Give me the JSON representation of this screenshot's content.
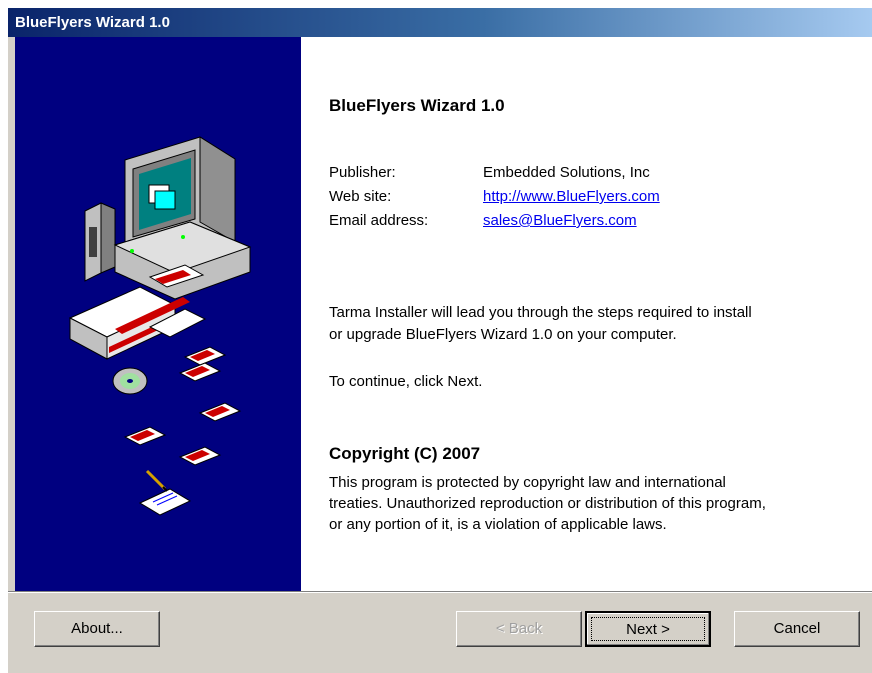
{
  "window": {
    "title": "BlueFlyers Wizard 1.0"
  },
  "main": {
    "heading": "BlueFlyers Wizard 1.0",
    "info": {
      "publisher_label": "Publisher:",
      "publisher_value": "Embedded Solutions, Inc",
      "website_label": "Web site:",
      "website_value": "http://www.BlueFlyers.com",
      "email_label": "Email address:",
      "email_value": "sales@BlueFlyers.com"
    },
    "intro_line1": "Tarma Installer will lead you through the steps required to install",
    "intro_line2": "or upgrade BlueFlyers Wizard 1.0 on your computer.",
    "continue_text": "To continue, click Next.",
    "copyright_heading": "Copyright (C) 2007",
    "copyright_line1": "This program is protected by copyright law and international",
    "copyright_line2": "treaties. Unauthorized reproduction or distribution of this program,",
    "copyright_line3": "or any portion of it, is a violation of applicable laws."
  },
  "buttons": {
    "about": "About...",
    "back": "< Back",
    "next": "Next >",
    "cancel": "Cancel"
  },
  "colors": {
    "sidebar": "#000080",
    "title_bar_start": "#0a246a",
    "link": "#0000ee",
    "dialog_face": "#d4d0c8"
  },
  "icons": [
    "computer-icon",
    "package-box-icon",
    "floppy-disk-icon",
    "cd-disc-icon",
    "document-pen-icon"
  ]
}
